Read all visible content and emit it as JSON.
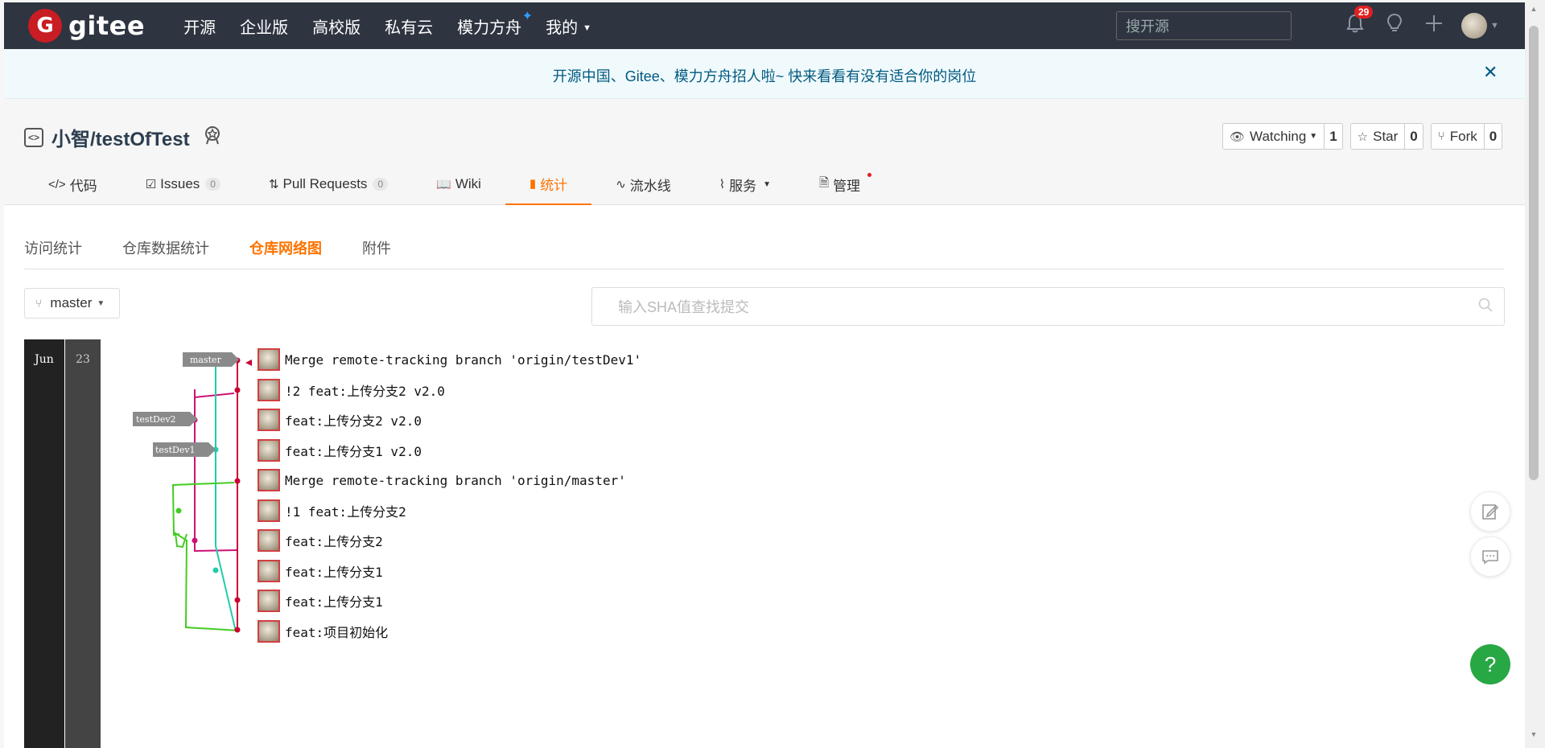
{
  "topnav": {
    "logo_letter": "G",
    "logo_text": "gitee",
    "links": [
      {
        "label": "开源"
      },
      {
        "label": "企业版"
      },
      {
        "label": "高校版"
      },
      {
        "label": "私有云"
      },
      {
        "label": "模力方舟"
      },
      {
        "label": "我的"
      }
    ],
    "search_placeholder": "搜开源",
    "notification_count": "29"
  },
  "banner": {
    "text": "开源中国、Gitee、模力方舟招人啦~ 快来看看有没有适合你的岗位",
    "close": "✕"
  },
  "repo": {
    "name": "小智/testOfTest",
    "watch_label": "Watching",
    "watch_count": "1",
    "star_label": "Star",
    "star_count": "0",
    "fork_label": "Fork",
    "fork_count": "0"
  },
  "tabs": [
    {
      "label": "代码"
    },
    {
      "label": "Issues",
      "count": "0"
    },
    {
      "label": "Pull Requests",
      "count": "0"
    },
    {
      "label": "Wiki"
    },
    {
      "label": "统计"
    },
    {
      "label": "流水线"
    },
    {
      "label": "服务"
    },
    {
      "label": "管理"
    }
  ],
  "subtabs": [
    {
      "label": "访问统计"
    },
    {
      "label": "仓库数据统计"
    },
    {
      "label": "仓库网络图"
    },
    {
      "label": "附件"
    }
  ],
  "branch_selector": {
    "value": "master"
  },
  "sha_search": {
    "placeholder": "输入SHA值查找提交"
  },
  "timeline": {
    "month": "Jun",
    "day": "23"
  },
  "branch_labels": [
    {
      "label": "master"
    },
    {
      "label": "testDev2"
    },
    {
      "label": "testDev1"
    }
  ],
  "commits": [
    {
      "message": "Merge remote-tracking branch 'origin/testDev1'"
    },
    {
      "message": "!2 feat:上传分支2 v2.0"
    },
    {
      "message": "feat:上传分支2 v2.0"
    },
    {
      "message": "feat:上传分支1 v2.0"
    },
    {
      "message": "Merge remote-tracking branch 'origin/master'"
    },
    {
      "message": "!1 feat:上传分支2"
    },
    {
      "message": "feat:上传分支2"
    },
    {
      "message": "feat:上传分支1"
    },
    {
      "message": "feat:上传分支1"
    },
    {
      "message": "feat:项目初始化"
    }
  ],
  "colors": {
    "accent": "#fe7300",
    "nav_bg": "#2e3440",
    "master_line": "#cc0033",
    "dev2_line": "#cc1177",
    "dev1_line": "#22ccaa",
    "dev_green": "#44cc22",
    "help_button": "#28a745"
  },
  "help_button": "?"
}
